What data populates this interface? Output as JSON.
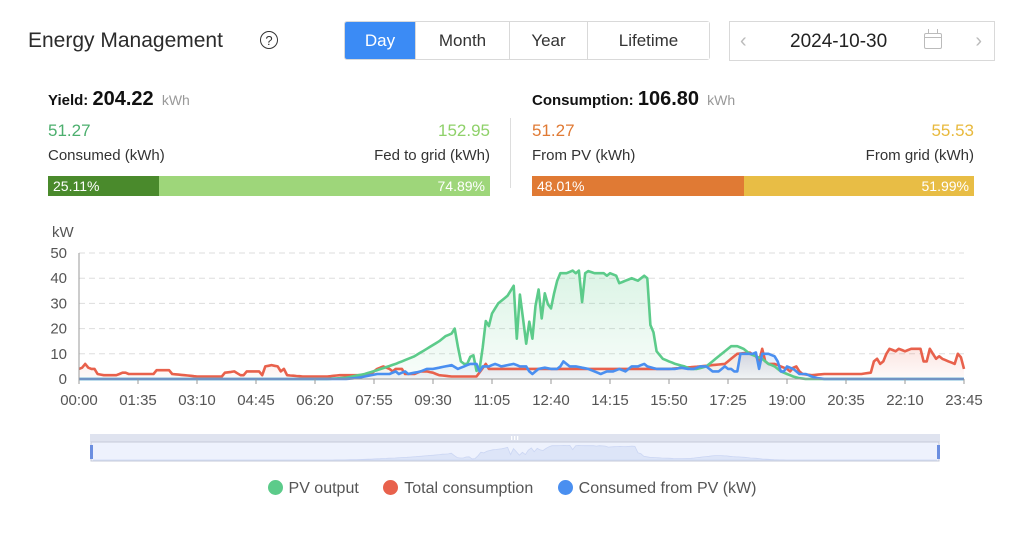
{
  "header": {
    "title": "Energy Management",
    "help_icon": "question-circle-icon",
    "tabs": [
      {
        "label": "Day",
        "active": true
      },
      {
        "label": "Month",
        "active": false
      },
      {
        "label": "Year",
        "active": false
      },
      {
        "label": "Lifetime",
        "active": false
      }
    ],
    "date": "2024-10-30",
    "prev_icon": "‹",
    "next_icon": "›"
  },
  "yield": {
    "label": "Yield:",
    "value": "204.22",
    "unit": "kWh",
    "consumed_value": "51.27",
    "consumed_label": "Consumed (kWh)",
    "fed_value": "152.95",
    "fed_label": "Fed to grid (kWh)",
    "consumed_pct_label": "25.11%",
    "fed_pct_label": "74.89%",
    "consumed_pct": 25.11,
    "colors": {
      "consumed_text": "#4caf6e",
      "fed_text": "#8fd16a",
      "consumed_bar": "#4a8a2c",
      "fed_bar": "#9ed67a"
    }
  },
  "consumption": {
    "label": "Consumption:",
    "value": "106.80",
    "unit": "kWh",
    "pv_value": "51.27",
    "pv_label": "From PV (kWh)",
    "grid_value": "55.53",
    "grid_label": "From grid (kWh)",
    "pv_pct_label": "48.01%",
    "grid_pct_label": "51.99%",
    "pv_pct": 48.01,
    "colors": {
      "pv_text": "#e07a34",
      "grid_text": "#e8b93c",
      "pv_bar": "#e07a34",
      "grid_bar": "#e8bd45"
    }
  },
  "legend": [
    {
      "label": "PV output",
      "color": "#5ccb8a"
    },
    {
      "label": "Total consumption",
      "color": "#e8614c"
    },
    {
      "label": "Consumed from PV (kW)",
      "color": "#4a8ff0"
    }
  ],
  "chart_data": {
    "type": "line",
    "title": "",
    "ylabel": "kW",
    "xlabel": "",
    "ylim": [
      0,
      50
    ],
    "yticks": [
      "0",
      "10",
      "20",
      "30",
      "40",
      "50"
    ],
    "xticks": [
      "00:00",
      "01:35",
      "03:10",
      "04:45",
      "06:20",
      "07:55",
      "09:30",
      "11:05",
      "12:40",
      "14:15",
      "15:50",
      "17:25",
      "19:00",
      "20:35",
      "22:10",
      "23:45"
    ],
    "x_range_minutes": [
      0,
      1425
    ],
    "grid": "horizontal-dashed",
    "legend_position": "bottom",
    "series": [
      {
        "name": "PV output",
        "color": "#5ccb8a",
        "area": true,
        "points_minutes_kw": [
          [
            0,
            0
          ],
          [
            400,
            0
          ],
          [
            430,
            0.5
          ],
          [
            460,
            2
          ],
          [
            480,
            3.5
          ],
          [
            510,
            6
          ],
          [
            540,
            9
          ],
          [
            560,
            12
          ],
          [
            580,
            15
          ],
          [
            590,
            17
          ],
          [
            600,
            18
          ],
          [
            605,
            20
          ],
          [
            610,
            13
          ],
          [
            615,
            7
          ],
          [
            620,
            6
          ],
          [
            628,
            6
          ],
          [
            633,
            13
          ],
          [
            638,
            4
          ],
          [
            643,
            2
          ],
          [
            648,
            7
          ],
          [
            652,
            18
          ],
          [
            655,
            23
          ],
          [
            660,
            21
          ],
          [
            665,
            26
          ],
          [
            675,
            30
          ],
          [
            690,
            33
          ],
          [
            695,
            35
          ],
          [
            700,
            37
          ],
          [
            705,
            16
          ],
          [
            708,
            38
          ],
          [
            712,
            29
          ],
          [
            716,
            22
          ],
          [
            720,
            14
          ],
          [
            724,
            24
          ],
          [
            728,
            19
          ],
          [
            730,
            16
          ],
          [
            734,
            27
          ],
          [
            738,
            35
          ],
          [
            742,
            36
          ],
          [
            746,
            20
          ],
          [
            750,
            34
          ],
          [
            754,
            30
          ],
          [
            760,
            28
          ],
          [
            765,
            34
          ],
          [
            770,
            39
          ],
          [
            775,
            42
          ],
          [
            785,
            42
          ],
          [
            795,
            43
          ],
          [
            800,
            42
          ],
          [
            805,
            43
          ],
          [
            808,
            20
          ],
          [
            812,
            41
          ],
          [
            818,
            43
          ],
          [
            830,
            42
          ],
          [
            845,
            42
          ],
          [
            850,
            41
          ],
          [
            855,
            42
          ],
          [
            865,
            41
          ],
          [
            870,
            38
          ],
          [
            880,
            39
          ],
          [
            890,
            40
          ],
          [
            900,
            39
          ],
          [
            905,
            40
          ],
          [
            910,
            41
          ],
          [
            915,
            40
          ],
          [
            922,
            14
          ],
          [
            926,
            20
          ],
          [
            930,
            11
          ],
          [
            940,
            8
          ],
          [
            960,
            6
          ],
          [
            975,
            5
          ],
          [
            985,
            4
          ],
          [
            995,
            4
          ],
          [
            1010,
            5
          ],
          [
            1020,
            7
          ],
          [
            1030,
            9
          ],
          [
            1040,
            11
          ],
          [
            1050,
            13
          ],
          [
            1060,
            13
          ],
          [
            1070,
            12
          ],
          [
            1080,
            10
          ],
          [
            1090,
            9
          ],
          [
            1100,
            8
          ],
          [
            1110,
            6
          ],
          [
            1120,
            5
          ],
          [
            1130,
            3
          ],
          [
            1140,
            2
          ],
          [
            1150,
            1
          ],
          [
            1160,
            0.3
          ],
          [
            1170,
            0
          ],
          [
            1425,
            0
          ]
        ]
      },
      {
        "name": "Total consumption",
        "color": "#e8614c",
        "area": true,
        "points_minutes_kw": [
          [
            0,
            4
          ],
          [
            5,
            4.5
          ],
          [
            10,
            6
          ],
          [
            15,
            4.5
          ],
          [
            20,
            4
          ],
          [
            25,
            4
          ],
          [
            30,
            2
          ],
          [
            40,
            1.5
          ],
          [
            60,
            1.5
          ],
          [
            70,
            2.5
          ],
          [
            75,
            2.5
          ],
          [
            80,
            2
          ],
          [
            100,
            2
          ],
          [
            120,
            2
          ],
          [
            125,
            3.5
          ],
          [
            145,
            3.5
          ],
          [
            150,
            2
          ],
          [
            170,
            1.5
          ],
          [
            190,
            1
          ],
          [
            210,
            1
          ],
          [
            230,
            1
          ],
          [
            235,
            2.5
          ],
          [
            250,
            3
          ],
          [
            260,
            1.5
          ],
          [
            265,
            1.5
          ],
          [
            270,
            3
          ],
          [
            290,
            3
          ],
          [
            295,
            1.5
          ],
          [
            300,
            5
          ],
          [
            310,
            5.5
          ],
          [
            320,
            5
          ],
          [
            325,
            3
          ],
          [
            330,
            4
          ],
          [
            335,
            1.5
          ],
          [
            360,
            1
          ],
          [
            380,
            1
          ],
          [
            400,
            1
          ],
          [
            420,
            1.5
          ],
          [
            440,
            1.5
          ],
          [
            460,
            1.5
          ],
          [
            470,
            2
          ],
          [
            480,
            4
          ],
          [
            490,
            5
          ],
          [
            500,
            4
          ],
          [
            505,
            3
          ],
          [
            510,
            4
          ],
          [
            520,
            4
          ],
          [
            525,
            2
          ],
          [
            540,
            2
          ],
          [
            550,
            3
          ],
          [
            560,
            3
          ],
          [
            570,
            2.5
          ],
          [
            580,
            1.5
          ],
          [
            600,
            1
          ],
          [
            640,
            1
          ],
          [
            655,
            6
          ],
          [
            660,
            4
          ],
          [
            700,
            4
          ],
          [
            800,
            4
          ],
          [
            900,
            4
          ],
          [
            950,
            4
          ],
          [
            1000,
            5
          ],
          [
            1040,
            6
          ],
          [
            1060,
            10
          ],
          [
            1080,
            10.5
          ],
          [
            1090,
            9
          ],
          [
            1095,
            7
          ],
          [
            1100,
            12
          ],
          [
            1105,
            7
          ],
          [
            1110,
            6
          ],
          [
            1120,
            6
          ],
          [
            1130,
            5
          ],
          [
            1140,
            4
          ],
          [
            1145,
            3
          ],
          [
            1150,
            4.5
          ],
          [
            1155,
            5
          ],
          [
            1160,
            3
          ],
          [
            1165,
            2
          ],
          [
            1180,
            1.5
          ],
          [
            1200,
            2
          ],
          [
            1240,
            2
          ],
          [
            1260,
            2
          ],
          [
            1275,
            2.5
          ],
          [
            1280,
            7
          ],
          [
            1285,
            8
          ],
          [
            1290,
            6
          ],
          [
            1295,
            7
          ],
          [
            1300,
            10
          ],
          [
            1305,
            12
          ],
          [
            1315,
            11
          ],
          [
            1320,
            12
          ],
          [
            1330,
            11
          ],
          [
            1340,
            12
          ],
          [
            1355,
            12
          ],
          [
            1360,
            7
          ],
          [
            1365,
            7
          ],
          [
            1370,
            12
          ],
          [
            1375,
            10
          ],
          [
            1380,
            8
          ],
          [
            1385,
            9
          ],
          [
            1390,
            8
          ],
          [
            1400,
            7
          ],
          [
            1410,
            6
          ],
          [
            1415,
            10
          ],
          [
            1418,
            6
          ],
          [
            1421,
            10
          ],
          [
            1425,
            4
          ]
        ]
      },
      {
        "name": "Consumed from PV (kW)",
        "color": "#4a8ff0",
        "area": true,
        "points_minutes_kw": [
          [
            0,
            0
          ],
          [
            430,
            0
          ],
          [
            450,
            0.5
          ],
          [
            470,
            1.5
          ],
          [
            480,
            2
          ],
          [
            500,
            2
          ],
          [
            510,
            3
          ],
          [
            515,
            2
          ],
          [
            525,
            3
          ],
          [
            530,
            2
          ],
          [
            540,
            2.5
          ],
          [
            550,
            3
          ],
          [
            560,
            4
          ],
          [
            570,
            4
          ],
          [
            580,
            4.5
          ],
          [
            590,
            5
          ],
          [
            600,
            5.5
          ],
          [
            610,
            4
          ],
          [
            620,
            5
          ],
          [
            630,
            6
          ],
          [
            640,
            6
          ],
          [
            645,
            3
          ],
          [
            650,
            5
          ],
          [
            660,
            5
          ],
          [
            670,
            6
          ],
          [
            680,
            5
          ],
          [
            690,
            5.5
          ],
          [
            700,
            6
          ],
          [
            710,
            5
          ],
          [
            720,
            5
          ],
          [
            725,
            3
          ],
          [
            730,
            2
          ],
          [
            740,
            4
          ],
          [
            750,
            4.5
          ],
          [
            760,
            4
          ],
          [
            770,
            4
          ],
          [
            775,
            5
          ],
          [
            780,
            7
          ],
          [
            790,
            5
          ],
          [
            800,
            5
          ],
          [
            820,
            4
          ],
          [
            830,
            3
          ],
          [
            840,
            2
          ],
          [
            850,
            3
          ],
          [
            860,
            3
          ],
          [
            870,
            4
          ],
          [
            880,
            3
          ],
          [
            890,
            5
          ],
          [
            900,
            5
          ],
          [
            910,
            6
          ],
          [
            915,
            5
          ],
          [
            930,
            4
          ],
          [
            950,
            4
          ],
          [
            960,
            4
          ],
          [
            970,
            4.5
          ],
          [
            980,
            4
          ],
          [
            990,
            4
          ],
          [
            1000,
            5
          ],
          [
            1010,
            5
          ],
          [
            1020,
            3
          ],
          [
            1030,
            3
          ],
          [
            1040,
            5
          ],
          [
            1045,
            4
          ],
          [
            1050,
            4
          ],
          [
            1055,
            3
          ],
          [
            1060,
            3
          ],
          [
            1065,
            10
          ],
          [
            1075,
            10
          ],
          [
            1085,
            10
          ],
          [
            1090,
            10.5
          ],
          [
            1095,
            4
          ],
          [
            1100,
            10
          ],
          [
            1110,
            10
          ],
          [
            1120,
            9
          ],
          [
            1125,
            7
          ],
          [
            1130,
            3
          ],
          [
            1135,
            3
          ],
          [
            1140,
            5
          ],
          [
            1150,
            4
          ],
          [
            1160,
            2
          ],
          [
            1170,
            2
          ],
          [
            1180,
            1
          ],
          [
            1190,
            0.3
          ],
          [
            1200,
            0
          ],
          [
            1425,
            0
          ]
        ]
      }
    ],
    "data_zoom": {
      "start_percent": 0,
      "end_percent": 100
    }
  }
}
